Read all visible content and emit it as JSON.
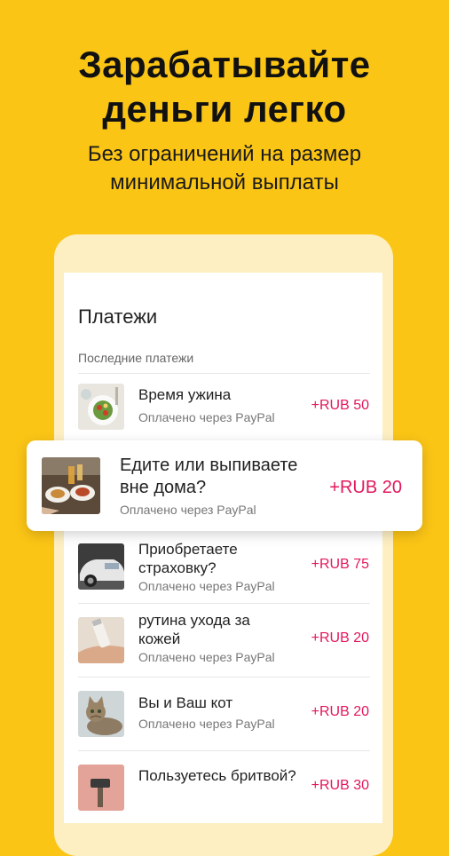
{
  "promo": {
    "headline_line1": "Зарабатывайте",
    "headline_line2": "деньги легко",
    "subhead_line1": "Без ограничений на размер",
    "subhead_line2": "минимальной выплаты"
  },
  "screen": {
    "title": "Платежи",
    "section_label": "Последние платежи"
  },
  "payments": [
    {
      "title_lines": [
        "Время ужина"
      ],
      "subtitle": "Оплачено через PayPal",
      "amount": "+RUB 50",
      "icon": "dinner-photo"
    },
    {
      "title_lines": [
        "Едите или выпиваете",
        "вне дома?"
      ],
      "subtitle": "Оплачено через PayPal",
      "amount": "+RUB 20",
      "icon": "restaurant-photo"
    },
    {
      "title_lines": [
        "Приобретаете",
        "страховку?"
      ],
      "subtitle": "Оплачено через PayPal",
      "amount": "+RUB 75",
      "icon": "car-photo"
    },
    {
      "title_lines": [
        "рутина ухода за",
        "кожей"
      ],
      "subtitle": "Оплачено через PayPal",
      "amount": "+RUB 20",
      "icon": "skincare-photo"
    },
    {
      "title_lines": [
        "Вы и Ваш кот"
      ],
      "subtitle": "Оплачено через PayPal",
      "amount": "+RUB 20",
      "icon": "cat-photo"
    },
    {
      "title_lines": [
        "Пользуетесь бритвой?"
      ],
      "subtitle": "Оплачено через PayPal",
      "amount": "+RUB 30",
      "icon": "razor-photo"
    }
  ],
  "colors": {
    "background": "#FBC516",
    "amount": "#E3175C"
  }
}
